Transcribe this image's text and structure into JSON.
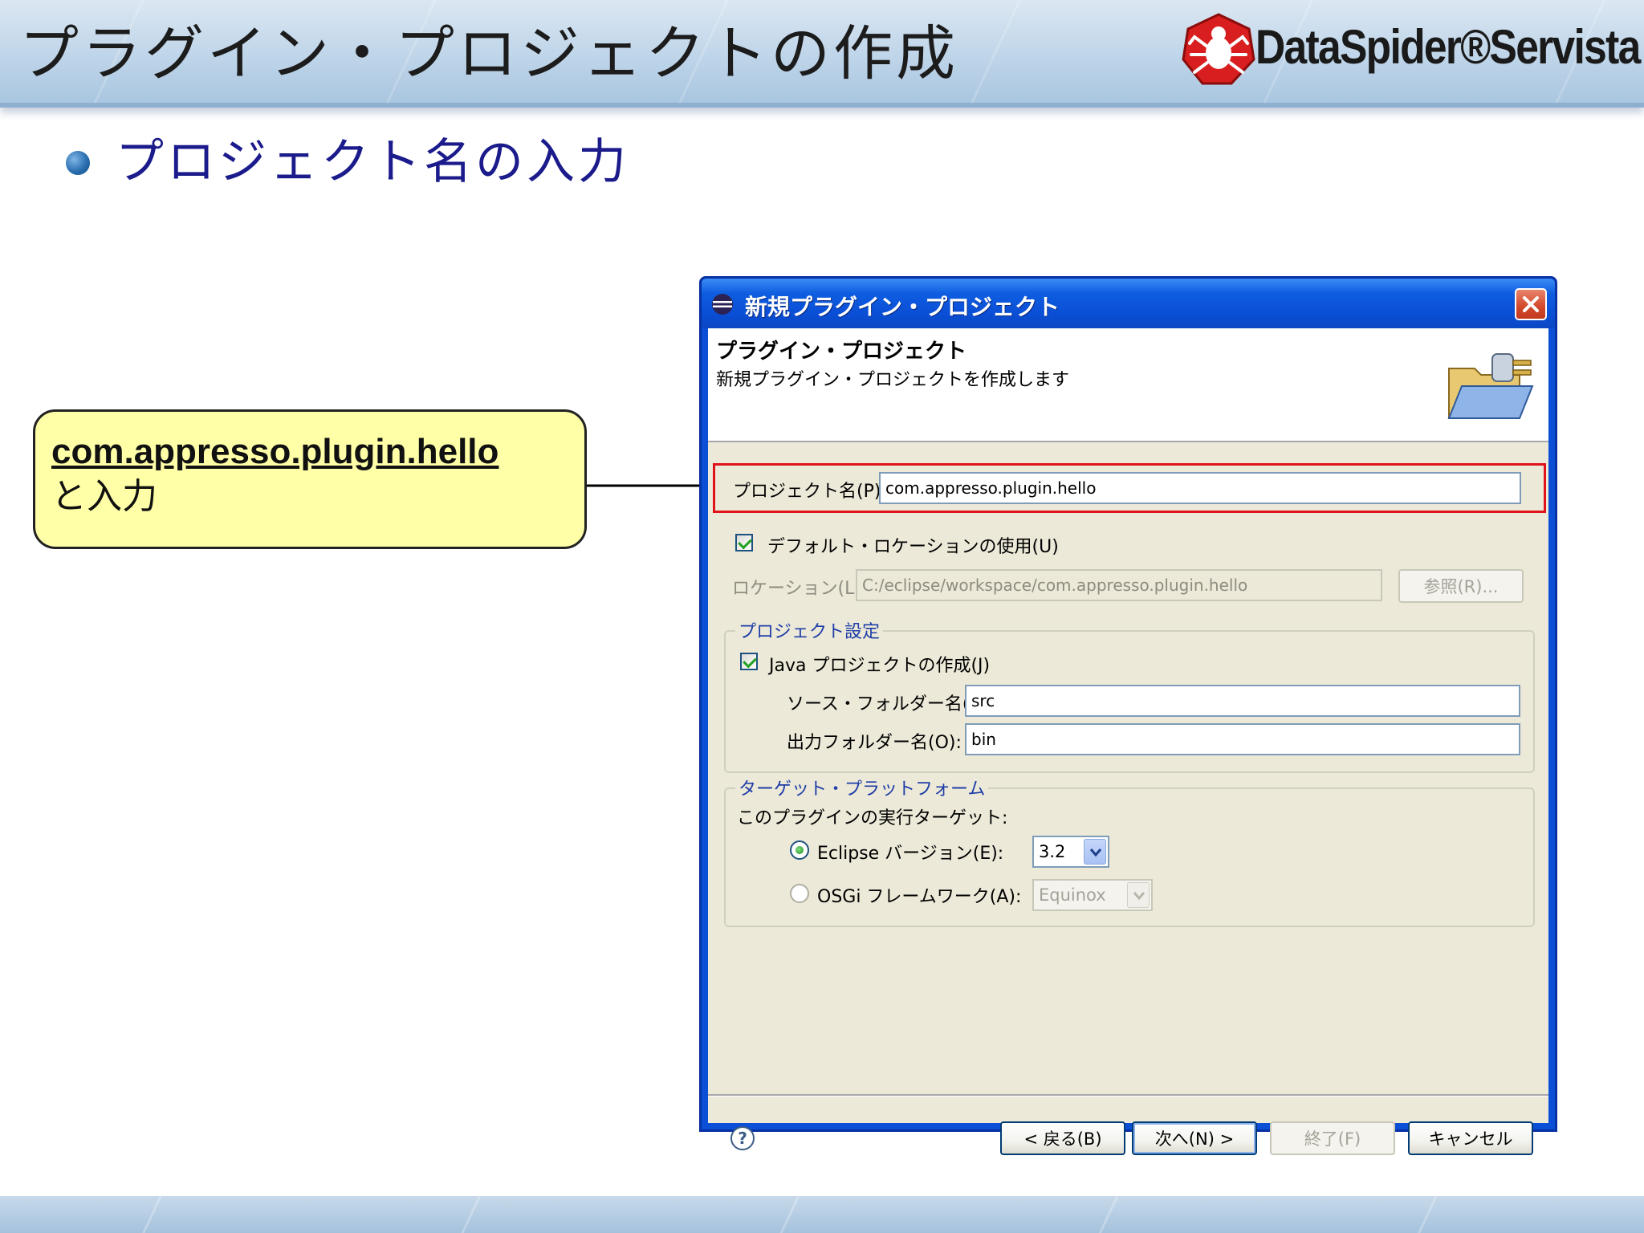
{
  "slide": {
    "title": "プラグイン・プロジェクトの作成",
    "logo_text": "DataSpider®Servista",
    "bullet": "プロジェクト名の入力",
    "colors": {
      "bullet_text": "#1b1b8c",
      "callout_bg": "#ffffa8",
      "highlight_border": "#e0121a"
    }
  },
  "callout": {
    "main": "com.appresso.plugin.hello",
    "sub": "と入力"
  },
  "dialog": {
    "window_title": "新規プラグイン・プロジェクト",
    "header_title": "プラグイン・プロジェクト",
    "header_desc": "新規プラグイン・プロジェクトを作成します",
    "project_name_label": "プロジェクト名(P):",
    "project_name_value": "com.appresso.plugin.hello",
    "use_default_location_label": "デフォルト・ロケーションの使用(U)",
    "use_default_location_checked": true,
    "location_label": "ロケーション(L):",
    "location_value": "C:/eclipse/workspace/com.appresso.plugin.hello",
    "browse_label": "参照(R)...",
    "project_settings_group": "プロジェクト設定",
    "create_java_project_label": "Java プロジェクトの作成(J)",
    "create_java_project_checked": true,
    "source_folder_label": "ソース・フォルダー名(S):",
    "source_folder_value": "src",
    "output_folder_label": "出力フォルダー名(O):",
    "output_folder_value": "bin",
    "target_platform_group": "ターゲット・プラットフォーム",
    "target_question": "このプラグインの実行ターゲット:",
    "eclipse_version_label": "Eclipse バージョン(E):",
    "eclipse_version_value": "3.2",
    "osgi_label": "OSGi フレームワーク(A):",
    "osgi_value": "Equinox",
    "buttons": {
      "back": "< 戻る(B)",
      "next": "次へ(N) >",
      "finish": "終了(F)",
      "cancel": "キャンセル"
    }
  }
}
